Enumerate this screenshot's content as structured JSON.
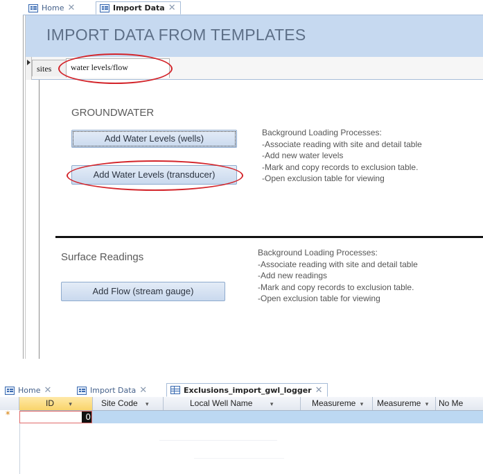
{
  "top_window": {
    "tabs": [
      {
        "label": "Home",
        "active": false,
        "icon": "form-icon"
      },
      {
        "label": "Import Data",
        "active": true,
        "icon": "form-icon"
      }
    ],
    "title": "IMPORT DATA FROM TEMPLATES",
    "page_tabs": [
      {
        "label": "sites",
        "selected": false
      },
      {
        "label": "water levels/flow",
        "selected": true
      }
    ],
    "groundwater": {
      "heading": "GROUNDWATER",
      "btn_wells": "Add Water Levels (wells)",
      "btn_transducer": "Add Water Levels (transducer)",
      "info": [
        "Background Loading Processes:",
        "-Associate reading with site and detail table",
        "-Add new water levels",
        "-Mark and copy records to exclusion table.",
        "-Open exclusion table for viewing"
      ]
    },
    "surface": {
      "heading": "Surface Readings",
      "btn_flow": "Add Flow (stream gauge)",
      "info": [
        "Background Loading Processes:",
        "-Associate reading with site and detail table",
        "-Add new readings",
        "-Mark and copy records to exclusion table.",
        "-Open exclusion table for viewing"
      ]
    },
    "highlight_color": "#d3242a"
  },
  "bottom_window": {
    "tabs": [
      {
        "label": "Home",
        "active": false,
        "icon": "form-icon"
      },
      {
        "label": "Import Data",
        "active": false,
        "icon": "form-icon"
      },
      {
        "label": "Exclusions_import_gwl_logger",
        "active": true,
        "icon": "table-icon"
      }
    ],
    "columns": [
      "ID",
      "Site Code",
      "Local Well Name",
      "Measureme",
      "Measureme",
      "No Me"
    ],
    "new_row_marker": "*",
    "new_row_id_value": "0"
  }
}
